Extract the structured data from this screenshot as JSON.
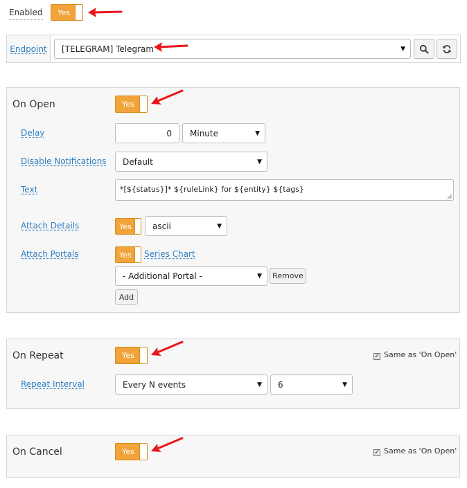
{
  "enabled": {
    "label": "Enabled",
    "toggle": "Yes"
  },
  "endpoint": {
    "label": "Endpoint",
    "value": "[TELEGRAM] Telegram",
    "search_icon": "search-icon",
    "refresh_icon": "refresh-icon"
  },
  "on_open": {
    "title": "On Open",
    "toggle": "Yes",
    "delay_label": "Delay",
    "delay_value": "0",
    "delay_unit": "Minute",
    "disable_notifications_label": "Disable Notifications",
    "disable_notifications_value": "Default",
    "text_label": "Text",
    "text_value": "*[${status}]* ${ruleLink} for ${entity} ${tags}",
    "attach_details_label": "Attach Details",
    "attach_details_toggle": "Yes",
    "attach_details_format": "ascii",
    "attach_portals_label": "Attach Portals",
    "attach_portals_toggle": "Yes",
    "series_chart_link": "Series Chart",
    "additional_portal": "- Additional Portal -",
    "remove_button": "Remove",
    "add_button": "Add"
  },
  "on_repeat": {
    "title": "On Repeat",
    "toggle": "Yes",
    "same_as_label": "Same as 'On Open'",
    "repeat_interval_label": "Repeat Interval",
    "repeat_mode": "Every N events",
    "repeat_count": "6"
  },
  "on_cancel": {
    "title": "On Cancel",
    "toggle": "Yes",
    "same_as_label": "Same as 'On Open'"
  },
  "colors": {
    "toggle_on": "#f0a43a",
    "link": "#2e7ec1",
    "annotation_arrow": "#e8161b"
  }
}
